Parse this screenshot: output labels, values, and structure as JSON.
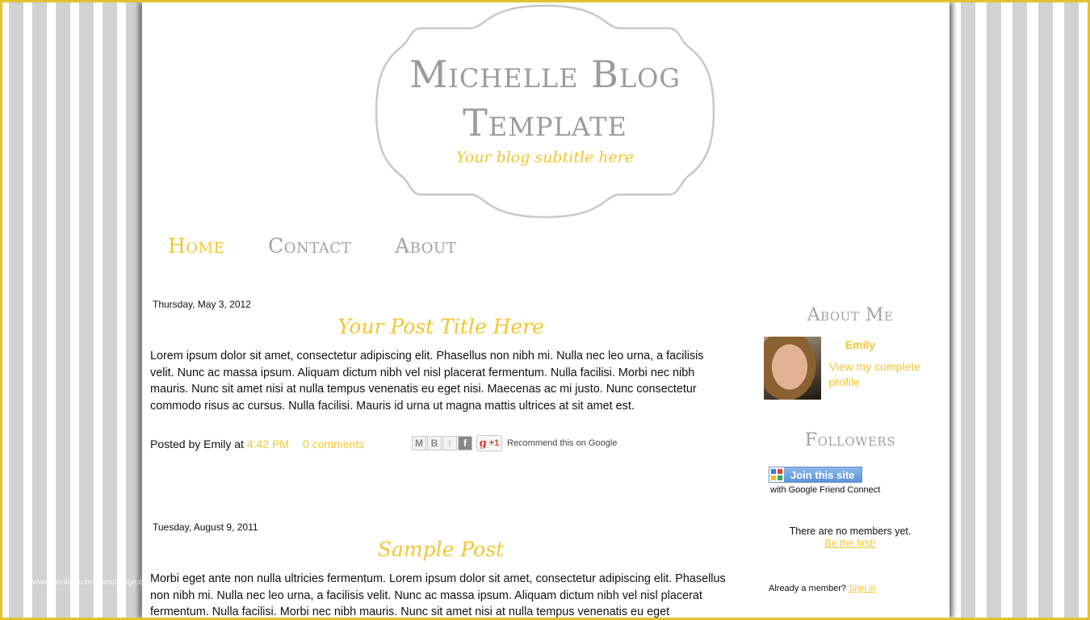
{
  "header": {
    "title_line1": "Michelle Blog",
    "title_line2": "Template",
    "subtitle": "Your blog subtitle here"
  },
  "nav": {
    "items": [
      {
        "label": "Home",
        "active": true
      },
      {
        "label": "Contact",
        "active": false
      },
      {
        "label": "About",
        "active": false
      }
    ]
  },
  "posts": [
    {
      "date": "Thursday, May 3, 2012",
      "title": "Your Post Title Here",
      "body": "Lorem ipsum dolor sit amet, consectetur adipiscing elit. Phasellus non nibh mi. Nulla nec leo urna, a facilisis velit. Nunc ac massa ipsum. Aliquam dictum nibh vel nisl placerat fermentum. Nulla facilisi. Morbi nec nibh mauris. Nunc sit amet nisi at nulla tempus venenatis eu eget nisi. Maecenas ac mi justo. Nunc consectetur commodo risus ac cursus. Nulla facilisi. Mauris id urna ut magna mattis ultrices at sit amet est.",
      "posted_by": "Posted by Emily at",
      "time": "4:42 PM",
      "comments": "0 comments",
      "share_buttons": [
        "email",
        "blogger",
        "twitter",
        "facebook"
      ],
      "gplus_label": "+1",
      "recommend_text": "Recommend this on Google"
    },
    {
      "date": "Tuesday, August 9, 2011",
      "title": "Sample Post",
      "body": "Morbi eget ante non nulla ultricies fermentum. Lorem ipsum dolor sit amet, consectetur adipiscing elit. Phasellus non nibh mi. Nulla nec leo urna, a facilisis velit. Nunc ac massa ipsum. Aliquam dictum nibh vel nisl placerat fermentum. Nulla facilisi. Morbi nec nibh mauris. Nunc sit amet nisi at nulla tempus venenatis eu eget"
    }
  ],
  "sidebar": {
    "about": {
      "title": "About Me",
      "name": "Emily",
      "profile_link": "View my complete profile"
    },
    "followers": {
      "title": "Followers",
      "join_label": "Join this site",
      "gfc_sub": "with Google Friend Connect",
      "no_members": "There are no members yet.",
      "be_first": "Be the first!",
      "already": "Already a member?",
      "sign_in": "Sign in"
    }
  },
  "watermark": "www.heritagechristiancollege.com",
  "colors": {
    "accent_yellow": "#fcd233",
    "text_yellow": "#f2c62e",
    "gray_heading": "#9b9b9b",
    "stripe_gray": "#d2d2d2",
    "frame_border": "#e2c232"
  }
}
